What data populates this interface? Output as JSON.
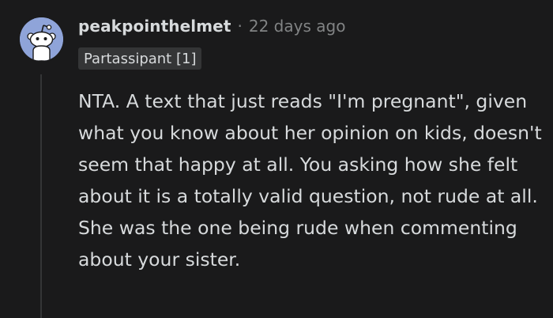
{
  "comment": {
    "username": "peakpointhelmet",
    "separator": "·",
    "timestamp": "22 days ago",
    "flair": "Partassipant [1]",
    "body": "NTA. A text that just reads \"I'm pregnant\", given what you know about her opinion on kids, doesn't seem that happy at all. You asking how she felt about it is a totally valid question, not rude at all. She was the one being rude when commenting about your sister."
  },
  "colors": {
    "background": "#1a1a1b",
    "text": "#d7dadc",
    "muted": "#818384",
    "avatar_bg": "#8fa4d9",
    "flair_bg": "#343536"
  },
  "icons": {
    "avatar": "snoo-avatar-icon"
  }
}
